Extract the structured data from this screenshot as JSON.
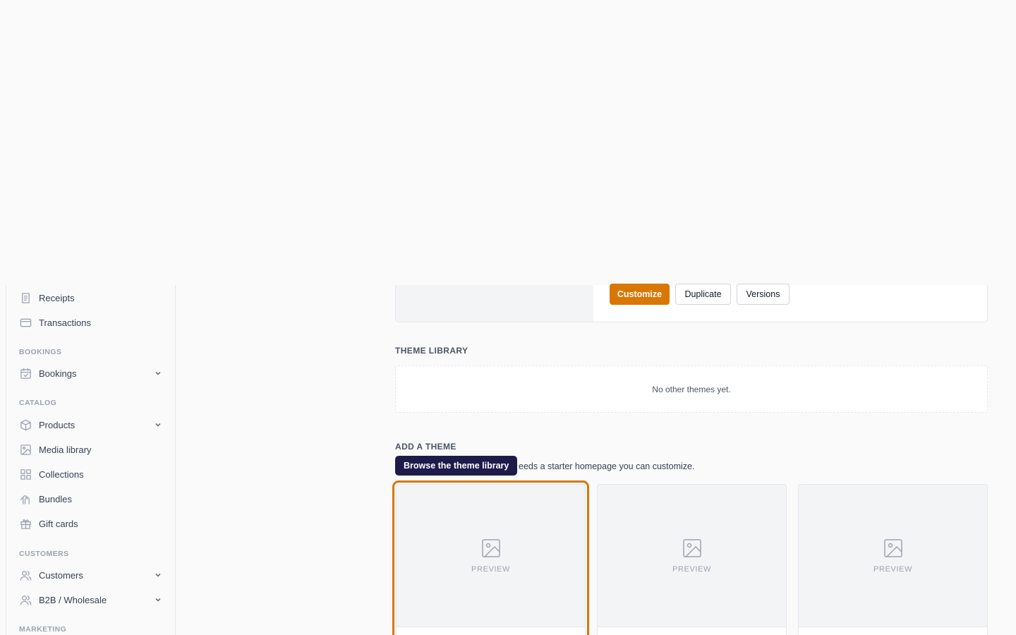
{
  "colors": {
    "accent": "#d97706",
    "tooltip_bg": "#1e1b4b",
    "muted": "#9ca3af"
  },
  "sidebar": {
    "items_top": [
      {
        "label": "Receipts",
        "icon": "receipt-icon"
      },
      {
        "label": "Transactions",
        "icon": "credit-card-icon"
      }
    ],
    "sections": {
      "bookings": "BOOKINGS",
      "catalog": "CATALOG",
      "customers": "CUSTOMERS",
      "marketing": "MARKETING"
    },
    "bookings": {
      "label": "Bookings",
      "icon": "calendar-check-icon"
    },
    "catalog": [
      {
        "label": "Products",
        "icon": "box-icon"
      },
      {
        "label": "Media library",
        "icon": "image-icon"
      },
      {
        "label": "Collections",
        "icon": "grid-icon"
      },
      {
        "label": "Bundles",
        "icon": "bundle-icon"
      },
      {
        "label": "Gift cards",
        "icon": "gift-icon"
      }
    ],
    "customers": [
      {
        "label": "Customers",
        "icon": "users-icon"
      },
      {
        "label": "B2B / Wholesale",
        "icon": "users-icon"
      }
    ]
  },
  "current_theme": {
    "customize": "Customize",
    "duplicate": "Duplicate",
    "versions": "Versions"
  },
  "theme_library": {
    "title": "THEME LIBRARY",
    "empty": "No other themes yet."
  },
  "add_theme": {
    "title": "ADD A THEME",
    "description_visible": "eeds a starter homepage you can customize.",
    "tooltip": "Browse the theme library",
    "templates": [
      {
        "preview": "PREVIEW"
      },
      {
        "preview": "PREVIEW"
      },
      {
        "preview": "PREVIEW"
      }
    ]
  }
}
